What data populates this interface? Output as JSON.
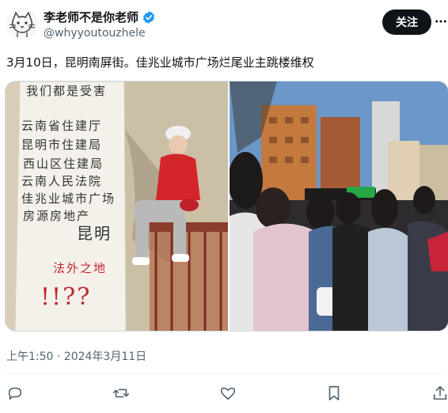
{
  "author": {
    "display_name": "李老师不是你老师",
    "handle": "@whyyoutouzhele",
    "verified_icon": "verified-badge-icon",
    "avatar_icon": "cat-sketch-avatar"
  },
  "follow_button": {
    "label": "关注"
  },
  "more_icon": "more-horizontal-icon",
  "tweet": {
    "text": "3月10日，昆明南屏街。佳兆业城市广场烂尾业主跳楼维权"
  },
  "media": {
    "left_photo": {
      "banner_lines": [
        "我们都是受害",
        "云南省住建厅",
        "昆明市住建局",
        "西山区住建局",
        "云南人民法院",
        "佳兆业城市广场",
        "房源房地产",
        "昆明",
        "法外之地",
        "!!??"
      ]
    },
    "right_photo": {
      "banner_lines": []
    }
  },
  "timestamp": "上午1:50 · 2024年3月11日",
  "actions": [
    {
      "name": "reply-icon"
    },
    {
      "name": "retweet-icon"
    },
    {
      "name": "like-icon"
    },
    {
      "name": "bookmark-icon"
    },
    {
      "name": "share-icon"
    }
  ],
  "colors": {
    "text_primary": "#0f1419",
    "text_secondary": "#536471",
    "verified_blue": "#1d9bf0",
    "button_dark": "#0f1419",
    "divider": "#eff3f4"
  }
}
